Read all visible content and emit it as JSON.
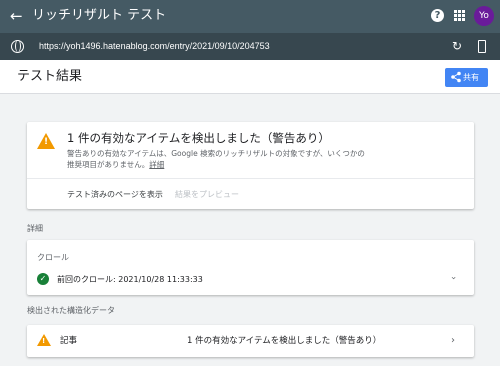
{
  "topbar": {
    "title": "リッチリザルト テスト",
    "back_icon": "arrow-left-icon",
    "avatar_initials": "Yo",
    "avatar_color": "#6a1b9a"
  },
  "urlbar": {
    "url": "https://yoh1496.hatenablog.com/entry/2021/09/10/204753"
  },
  "header": {
    "title": "テスト結果",
    "share_label": "共有",
    "share_color": "#4285f4"
  },
  "result": {
    "heading": "1 件の有効なアイテムを検出しました（警告あり）",
    "description": "警告ありの有効なアイテムは、Google 検索のリッチリザルトの対象ですが、いくつかの推奨項目がありません。",
    "description_link": "詳細",
    "tested_page_link": "テスト済みのページを表示",
    "preview_link": "結果をプレビュー",
    "warning_color": "#f29900"
  },
  "details": {
    "section_label": "詳細",
    "crawl_title": "クロール",
    "crawl_status": "前回のクロール: 2021/10/28 11:33:33",
    "ok_color": "#188038"
  },
  "structured_data": {
    "section_label": "検出された構造化データ",
    "items": [
      {
        "label": "記事",
        "status": "1 件の有効なアイテムを検出しました（警告あり）"
      }
    ]
  }
}
